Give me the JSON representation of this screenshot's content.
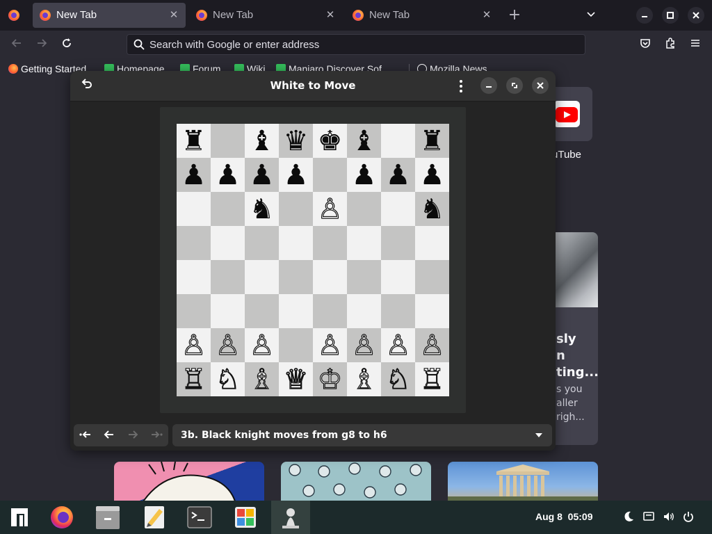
{
  "browser": {
    "tabs": [
      {
        "title": "New Tab",
        "active": true
      },
      {
        "title": "New Tab",
        "active": false
      },
      {
        "title": "New Tab",
        "active": false
      }
    ],
    "new_tab_symbol": "+",
    "list_tabs_symbol": "⌄",
    "window_controls": {
      "minimize": "–",
      "maximize": "▪",
      "close": "✕"
    },
    "address_bar": {
      "placeholder": "Search with Google or enter address",
      "value": ""
    },
    "bookmarks": [
      {
        "label": "Getting Started",
        "icon": "firefox-icon"
      },
      {
        "label": "Homepage",
        "icon": "manjaro-icon"
      },
      {
        "label": "Forum",
        "icon": "manjaro-icon"
      },
      {
        "label": "Wiki",
        "icon": "manjaro-icon"
      },
      {
        "label": "Manjaro Discover Sof...",
        "icon": "manjaro-icon"
      },
      {
        "label": "Mozilla News",
        "icon": "globe-icon"
      }
    ]
  },
  "newtab": {
    "shortcut_label": "uTube",
    "story": {
      "title_lines": [
        "sly",
        "n",
        "ting..."
      ],
      "excerpt_lines": [
        "s you",
        "aller",
        "righ..."
      ]
    }
  },
  "chess": {
    "title": "White to Move",
    "board_rows": [
      [
        "♜",
        "",
        "♝",
        "♛",
        "♚",
        "♝",
        "",
        "♜"
      ],
      [
        "♟",
        "♟",
        "♟",
        "♟",
        "",
        "♟",
        "♟",
        "♟"
      ],
      [
        "",
        "",
        "♞",
        "",
        "♙",
        "",
        "",
        "♞"
      ],
      [
        "",
        "",
        "",
        "",
        "",
        "",
        "",
        ""
      ],
      [
        "",
        "",
        "",
        "",
        "",
        "",
        "",
        ""
      ],
      [
        "",
        "",
        "",
        "",
        "",
        "",
        "",
        ""
      ],
      [
        "♙",
        "♙",
        "♙",
        "",
        "♙",
        "♙",
        "♙",
        "♙"
      ],
      [
        "♖",
        "♘",
        "♗",
        "♕",
        "♔",
        "♗",
        "♘",
        "♖"
      ]
    ],
    "history_buttons": [
      "•⭠",
      "⭠",
      "⭢",
      "⭢•"
    ],
    "current_move": "3b. Black knight moves from g8 to h6"
  },
  "taskbar": {
    "apps": [
      "manjaro-menu-icon",
      "firefox-icon",
      "files-icon",
      "text-editor-icon",
      "terminal-icon",
      "software-icon",
      "chess-icon"
    ],
    "date": "Aug 8",
    "time": "05:09"
  },
  "colors": {
    "chess_window_bg": "#242424",
    "board_light": "#f2f2f2",
    "board_dark": "#c4c4c3",
    "taskbar_bg": "#1c2a2b"
  }
}
